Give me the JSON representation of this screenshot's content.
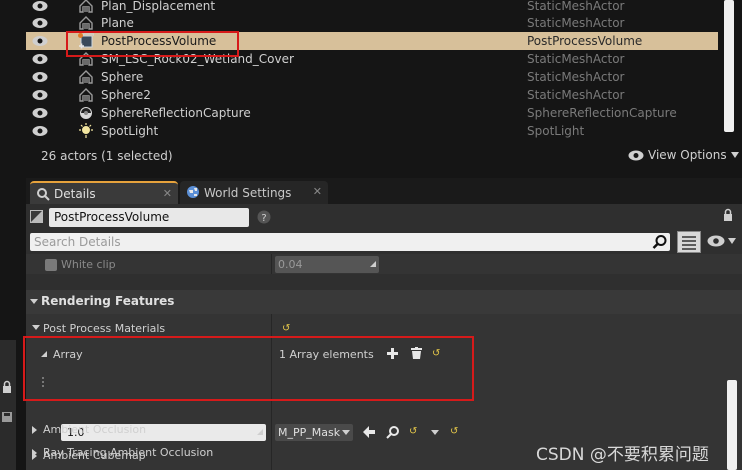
{
  "outliner": {
    "rows": [
      {
        "name": "Plan_Displacement",
        "type": "StaticMeshActor",
        "icon": "static-mesh-icon"
      },
      {
        "name": "Plane",
        "type": "StaticMeshActor",
        "icon": "static-mesh-icon"
      },
      {
        "name": "PostProcessVolume",
        "type": "PostProcessVolume",
        "icon": "post-process-volume-icon",
        "selected": true
      },
      {
        "name": "SM_LSC_Rock02_Wetland_Cover",
        "type": "StaticMeshActor",
        "icon": "static-mesh-icon"
      },
      {
        "name": "Sphere",
        "type": "StaticMeshActor",
        "icon": "static-mesh-icon"
      },
      {
        "name": "Sphere2",
        "type": "StaticMeshActor",
        "icon": "static-mesh-icon"
      },
      {
        "name": "SphereReflectionCapture",
        "type": "SphereReflectionCapture",
        "icon": "reflection-capture-icon"
      },
      {
        "name": "SpotLight",
        "type": "SpotLight",
        "icon": "spot-light-icon"
      }
    ],
    "actor_count": "26 actors (1 selected)",
    "view_options": "View Options"
  },
  "tabs": {
    "details": "Details",
    "world_settings": "World Settings"
  },
  "details": {
    "actor_name": "PostProcessVolume",
    "search_placeholder": "Search Details",
    "white_clip_label": "White clip",
    "white_clip_value": "0.04",
    "rendering_features": "Rendering Features",
    "post_process_materials": "Post Process Materials",
    "array_label": "Array",
    "array_elements": "1 Array elements",
    "array_entry_value": "1.0",
    "material_name": "M_PP_Mask",
    "ambient_cubemap": "Ambient Cubemap",
    "ambient_occlusion": "Ambient Occlusion",
    "ray_tracing_ao": "Ray Tracing Ambient Occlusion"
  },
  "watermark": "CSDN @不要积累问题",
  "colors": {
    "selection": "#d7c09a",
    "accent_tab": "#e6a23c",
    "annotation_box": "#d61a1a",
    "reset_arrow": "#e6c84a"
  }
}
